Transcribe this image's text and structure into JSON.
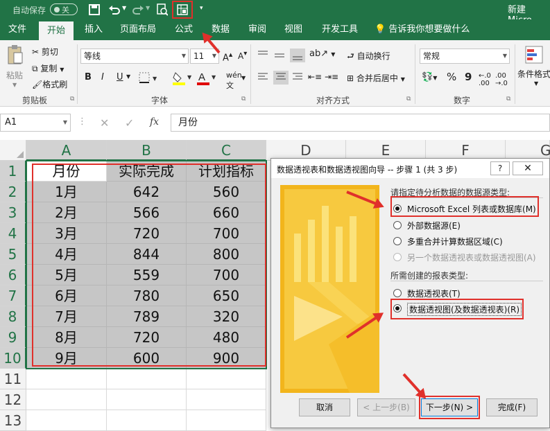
{
  "titlebar": {
    "autosave_label": "自动保存",
    "autosave_state": "关",
    "title": "新建 Micro"
  },
  "tabs": [
    {
      "label": "文件"
    },
    {
      "label": "开始"
    },
    {
      "label": "插入"
    },
    {
      "label": "页面布局"
    },
    {
      "label": "公式"
    },
    {
      "label": "数据"
    },
    {
      "label": "审阅"
    },
    {
      "label": "视图"
    },
    {
      "label": "开发工具"
    }
  ],
  "tell_me": "告诉我你想要做什么",
  "ribbon": {
    "paste": "粘贴",
    "cut": "剪切",
    "copy": "复制",
    "format_painter": "格式刷",
    "clipboard_group": "剪贴板",
    "font_name": "等线",
    "font_size": "11",
    "bold": "B",
    "italic": "I",
    "underline": "U",
    "font_group": "字体",
    "wrap_text": "自动换行",
    "merge_center": "合并后居中",
    "alignment_group": "对齐方式",
    "number_format": "常规",
    "percent": "%",
    "comma": "9",
    "number_group": "数字",
    "conditional_format": "条件格式"
  },
  "formula_bar": {
    "name_box": "A1",
    "fx": "fx",
    "content": "月份"
  },
  "columns": [
    "A",
    "B",
    "C",
    "D",
    "E",
    "F",
    "G"
  ],
  "rows": [
    "1",
    "2",
    "3",
    "4",
    "5",
    "6",
    "7",
    "8",
    "9",
    "10",
    "11",
    "12",
    "13"
  ],
  "table": {
    "header": [
      "月份",
      "实际完成",
      "计划指标"
    ],
    "data": [
      [
        "1月",
        "642",
        "560"
      ],
      [
        "2月",
        "566",
        "660"
      ],
      [
        "3月",
        "720",
        "700"
      ],
      [
        "4月",
        "844",
        "800"
      ],
      [
        "5月",
        "559",
        "700"
      ],
      [
        "6月",
        "780",
        "650"
      ],
      [
        "7月",
        "789",
        "320"
      ],
      [
        "8月",
        "720",
        "480"
      ],
      [
        "9月",
        "600",
        "900"
      ]
    ]
  },
  "dialog": {
    "title": "数据透视表和数据透视图向导 -- 步骤 1 (共 3 步)",
    "help": "?",
    "section1": "请指定待分析数据的数据源类型:",
    "source_options": [
      {
        "label": "Microsoft Excel 列表或数据库(M)",
        "selected": true,
        "disabled": false
      },
      {
        "label": "外部数据源(E)",
        "selected": false,
        "disabled": false
      },
      {
        "label": "多重合并计算数据区域(C)",
        "selected": false,
        "disabled": false
      },
      {
        "label": "另一个数据透视表或数据透视图(A)",
        "selected": false,
        "disabled": true
      }
    ],
    "section2": "所需创建的报表类型:",
    "report_options": [
      {
        "label": "数据透视表(T)",
        "selected": false
      },
      {
        "label": "数据透视图(及数据透视表)(R)",
        "selected": true
      }
    ],
    "buttons": {
      "cancel": "取消",
      "back": "< 上一步(B)",
      "next": "下一步(N) >",
      "finish": "完成(F)"
    }
  },
  "colors": {
    "excel_green": "#217346",
    "highlight_red": "#e0302b",
    "selection_gray": "#c6c6c6"
  }
}
